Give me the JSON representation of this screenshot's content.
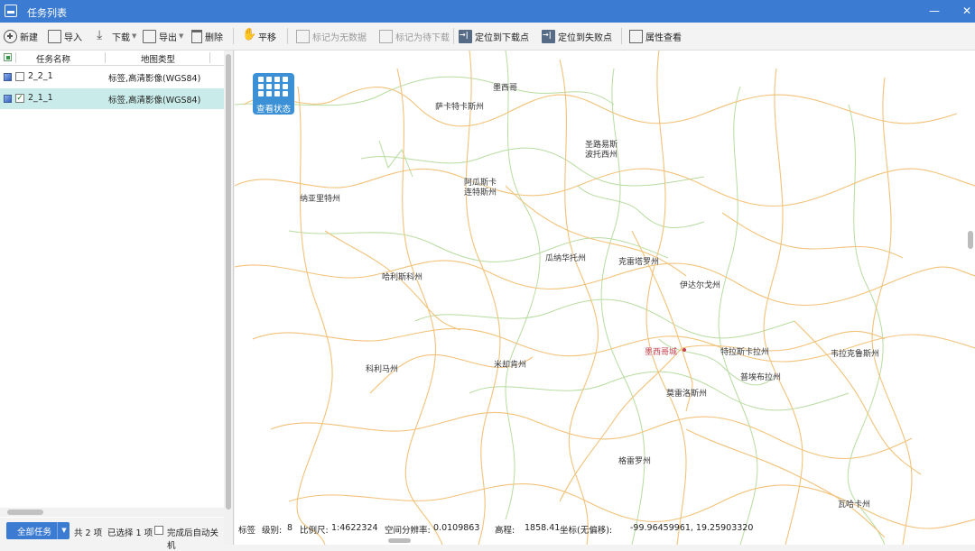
{
  "window": {
    "title": "任务列表",
    "minimize": "—",
    "maximize": "☐",
    "close": "✕"
  },
  "toolbar": {
    "new": "新建",
    "import": "导入",
    "download": "下载",
    "export": "导出",
    "delete": "删除",
    "pan": "平移",
    "mark_no_data": "标记为无数据",
    "mark_pending": "标记为待下载",
    "locate_downloaded": "定位到下载点",
    "locate_failed": "定位到失败点",
    "properties": "属性查看"
  },
  "task_list": {
    "headers": {
      "name": "任务名称",
      "type": "地图类型"
    },
    "rows": [
      {
        "name": "2_2_1",
        "type": "标签,高清影像(WGS84)",
        "checked": false,
        "selected": false
      },
      {
        "name": "2_1_1",
        "type": "标签,高清影像(WGS84)",
        "checked": true,
        "selected": true
      }
    ]
  },
  "footer": {
    "all_tasks": "全部任务",
    "total": "共 2 项",
    "selected": "已选择 1 项",
    "auto_shutdown": "完成后自动关机"
  },
  "map": {
    "status_button": "查看状态",
    "labels": [
      "墨西哥",
      "萨卡特卡斯州",
      "圣路易斯\n波托西州",
      "阿瓜斯卡\n连特斯州",
      "纳亚里特州",
      "瓜纳华托州",
      "克雷塔罗州",
      "哈利斯科州",
      "伊达尔戈州",
      "墨西哥城",
      "特拉斯卡拉州",
      "韦拉克鲁斯州",
      "科利马州",
      "米却肯州",
      "普埃布拉州",
      "莫雷洛斯州",
      "格雷罗州",
      "瓦哈卡州"
    ]
  },
  "statusbar": {
    "layer": "标签",
    "level_label": "级别:",
    "level": "8",
    "scale_label": "比例尺:",
    "scale": "1:4622324",
    "resolution_label": "空间分辨率:",
    "resolution": "0.0109863",
    "elevation_label": "高程:",
    "elevation": "1858.41",
    "coord_label": "坐标(无偏移):",
    "coord": "-99.96459961, 19.25903320"
  },
  "colors": {
    "titlebar": "#3c7bd2",
    "selected_row": "#c9ecea",
    "capital": "#c3404c",
    "road_orange": "#f2c27a",
    "road_green": "#b7dca0"
  }
}
